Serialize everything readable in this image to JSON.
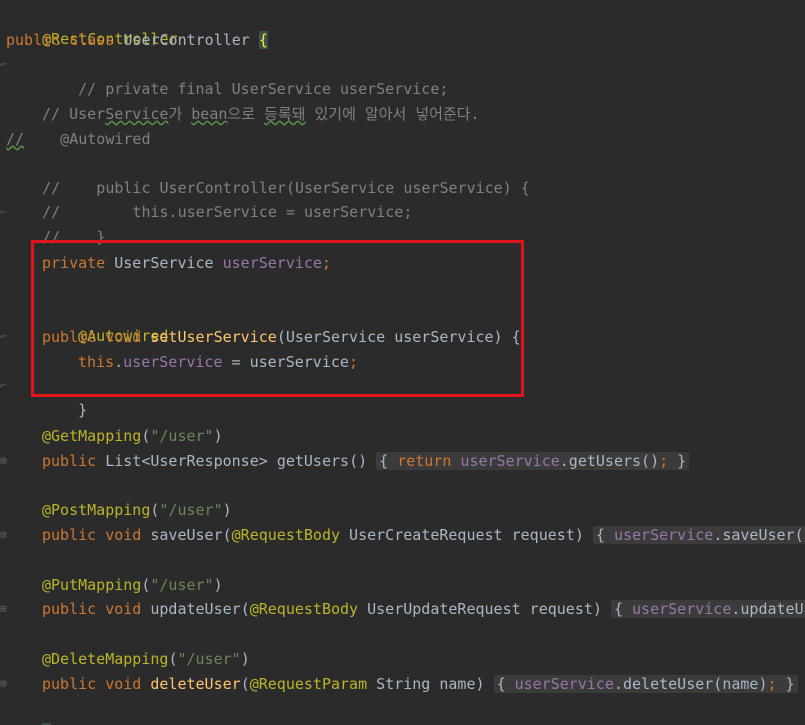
{
  "code": {
    "l1": "@RestController",
    "l2_kw": "public class",
    "l2_name": "UserController",
    "l2_brace": "{",
    "l3": "// private final UserService userService;",
    "l5_a": "// User",
    "l5_b": "Service",
    "l5_c": "가 ",
    "l5_d": "bean",
    "l5_e": "으로 ",
    "l5_f": "등록돼",
    "l5_g": " 있기에 알아서 넣어준다.",
    "l6_a": "//",
    "l6_b": "    @Autowired",
    "l7": "//    public UserController(UserService userService) {",
    "l8": "//        this.userService = userService;",
    "l9": "//    }",
    "l11_kw": "private",
    "l11_type": " UserService ",
    "l11_field": "userService",
    "l11_semi": ";",
    "l13": "@Autowired",
    "l14_kw": "public void",
    "l14_method": " setUserService",
    "l14_rest": "(UserService userService) {",
    "l15_kw": "this",
    "l15_dot": ".",
    "l15_field": "userService",
    "l15_rest": " = userService",
    "l15_semi": ";",
    "l16": "}",
    "l18_anno": "@GetMapping",
    "l18_open": "(",
    "l18_str": "\"/user\"",
    "l18_close": ")",
    "l19_kw": "public",
    "l19_type": " List<UserResponse> ",
    "l19_method": "getUsers",
    "l19_paren": "() ",
    "l19_fold_open": "{ ",
    "l19_return": "return",
    "l19_field": " userService",
    "l19_call": ".getUsers()",
    "l19_semi": ";",
    "l19_fold_close": " }",
    "l21_anno": "@PostMapping",
    "l21_open": "(",
    "l21_str": "\"/user\"",
    "l21_close": ")",
    "l22_kw": "public void",
    "l22_method": " saveUser",
    "l22_p1": "(",
    "l22_anno": "@RequestBody",
    "l22_rest": " UserCreateRequest request) ",
    "l22_fold_open": "{ ",
    "l22_field": "userService",
    "l22_call": ".saveUser(r",
    "l24_anno": "@PutMapping",
    "l24_open": "(",
    "l24_str": "\"/user\"",
    "l24_close": ")",
    "l25_kw": "public void",
    "l25_method": " updateUser",
    "l25_p1": "(",
    "l25_anno": "@RequestBody",
    "l25_rest": " UserUpdateRequest request) ",
    "l25_fold_open": "{ ",
    "l25_field": "userService",
    "l25_call": ".updateUs",
    "l27_anno": "@DeleteMapping",
    "l27_open": "(",
    "l27_str": "\"/user\"",
    "l27_close": ")",
    "l28_kw": "public void",
    "l28_method": " deleteUser",
    "l28_p1": "(",
    "l28_anno": "@RequestParam",
    "l28_rest": " String name) ",
    "l28_fold_open": "{ ",
    "l28_field": "userService",
    "l28_call": ".deleteUser(name)",
    "l28_semi": ";",
    "l28_fold_close": " }",
    "l29": "}"
  },
  "colors": {
    "background": "#2b2b2b",
    "keyword": "#cc7832",
    "annotation": "#bbb529",
    "field": "#9876aa",
    "string": "#6a8759",
    "method": "#ffc66d",
    "comment": "#808080",
    "highlight_box": "#e0141a"
  }
}
